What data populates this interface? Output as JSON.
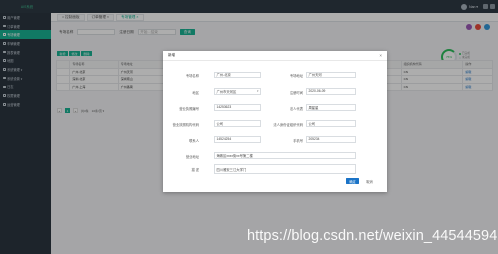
{
  "app": {
    "logo": "AIS系统"
  },
  "header": {
    "user_name": "Nan ▾"
  },
  "sidebar": {
    "items": [
      {
        "label": "用户管理"
      },
      {
        "label": "订单管理"
      },
      {
        "label": "专场管理",
        "active": true
      },
      {
        "label": "车辆管理"
      },
      {
        "label": "报表管理"
      },
      {
        "label": "地图"
      },
      {
        "label": "系统管理 ▾"
      },
      {
        "label": "系统设置 ▾"
      },
      {
        "label": "日志"
      },
      {
        "label": "权限管理"
      },
      {
        "label": "运营管理"
      }
    ]
  },
  "tabs": [
    {
      "label": "⌂ 控制面板"
    },
    {
      "label": "订单管理 ×"
    },
    {
      "label": "专场管理 ×",
      "active": true
    }
  ],
  "filters": {
    "name_label": "专场名称",
    "date_label": "注册日期",
    "date_placeholder": "开始 - 结束",
    "query_button": "查询"
  },
  "toolbar": {
    "buttons": [
      "新增",
      "修改",
      "删除"
    ]
  },
  "table": {
    "headers": [
      "",
      "专场名称",
      "专场地址",
      "专场区域",
      "营业数",
      "法人代表",
      "注册日期",
      "法人身份证",
      "组织机构代码",
      "操作"
    ],
    "rows": [
      [
        "",
        "广州-北京",
        "广州天河",
        "天河区",
        "1",
        "张三",
        "2020-06-09",
        "440xxxx",
        "CN",
        "编辑"
      ],
      [
        "",
        "深圳-北京",
        "深圳南山",
        "南山区",
        "2",
        "李四",
        "2020-06-10",
        "440xxxx",
        "CN",
        "编辑"
      ],
      [
        "",
        "广州-上海",
        "广州番禺",
        "番禺区",
        "1",
        "王五",
        "2020-06-11",
        "440xxxx",
        "CN",
        "编辑"
      ]
    ]
  },
  "pager": {
    "prev": "«",
    "current": "1",
    "next": "»",
    "info": "共3条",
    "size": "10条/页 ▾"
  },
  "gauge": {
    "value": "75%",
    "legend": [
      "已完成",
      "未完成"
    ]
  },
  "colors": {
    "accent": "#1ab394",
    "primary": "#1a73c7",
    "sidebar": "#2b3540",
    "topbar": "#2f3a45",
    "gauge": "#2fbf5e"
  },
  "modal": {
    "title": "新增",
    "close_icon": "close-icon",
    "labels": {
      "name": "专场名称",
      "address": "专场地址",
      "region": "地区",
      "reg_date": "注册时间",
      "license": "营业执照编号",
      "legal_person": "法人代表",
      "org_code": "营业执照机构代码",
      "legal_id": "法人身份证组织代码",
      "contact": "联系人",
      "phone": "手机号",
      "detail_address": "营业地址",
      "remark": "描 述"
    },
    "values": {
      "name": "广州-北京",
      "address": "广州天河",
      "region": "广州市天河区",
      "reg_date": "2020-06-09",
      "license": "14253623",
      "legal_person": "周星星",
      "org_code": "公司",
      "legal_id": "公司",
      "contact": "14524254",
      "phone": "205234",
      "detail_address": "海珠区xxxx街xx号第二楼",
      "remark": "四川雅安三江大学门"
    },
    "ok_button": "确定",
    "cancel_button": "取消"
  },
  "watermark": "https://blog.csdn.net/weixin_44544594"
}
